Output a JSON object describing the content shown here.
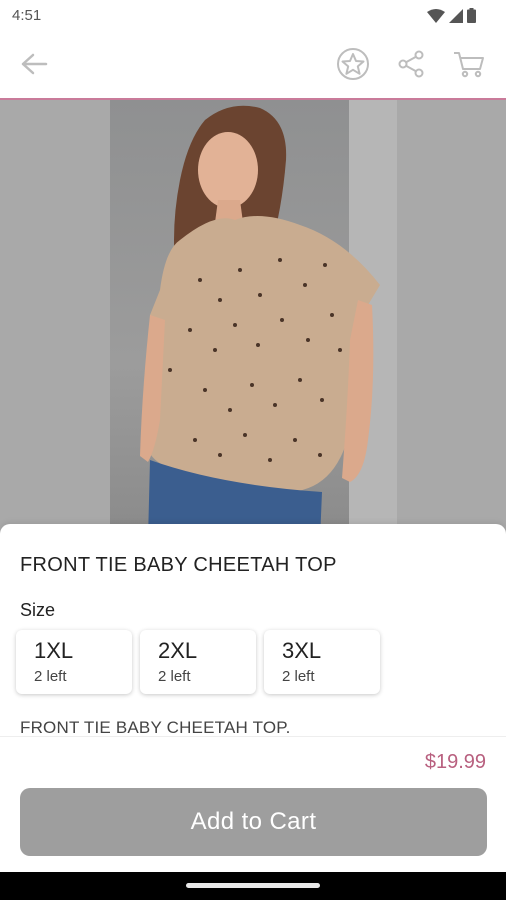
{
  "status_bar": {
    "time": "4:51",
    "icons": [
      "wifi-icon",
      "signal-icon",
      "battery-icon"
    ]
  },
  "app_bar": {
    "icons": [
      "back-arrow-icon",
      "star-icon",
      "share-icon",
      "cart-icon"
    ]
  },
  "product": {
    "title": "FRONT TIE BABY CHEETAH TOP",
    "size_label": "Size",
    "sizes": [
      {
        "name": "1XL",
        "stock": "2 left"
      },
      {
        "name": "2XL",
        "stock": "2 left"
      },
      {
        "name": "3XL",
        "stock": "2 left"
      }
    ],
    "description": "FRONT TIE BABY CHEETAH TOP."
  },
  "footer": {
    "price": "$19.99",
    "add_to_cart_label": "Add to Cart"
  },
  "colors": {
    "accent": "#c97b9a",
    "price": "#b8607f",
    "button": "#9e9e9e"
  }
}
